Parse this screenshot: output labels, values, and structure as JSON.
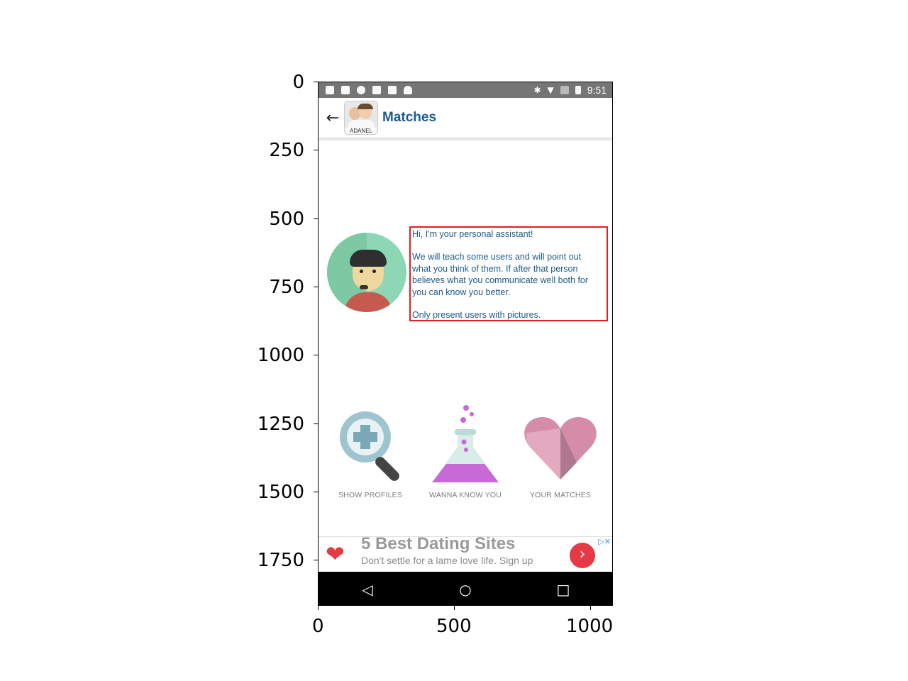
{
  "axes": {
    "y_ticks": [
      "0",
      "250",
      "500",
      "750",
      "1000",
      "1250",
      "1500",
      "1750"
    ],
    "x_ticks": [
      "0",
      "500",
      "1000"
    ]
  },
  "status_bar": {
    "time": "9:51",
    "left_icons": [
      "facebook-icon",
      "gallery-icon",
      "info-icon",
      "lock-icon",
      "tools-icon",
      "android-icon"
    ],
    "right_icons": [
      "bluetooth-icon",
      "wifi-icon",
      "no-signal-icon",
      "battery-icon"
    ]
  },
  "app_bar": {
    "back_icon": "arrow-left-icon",
    "logo_text": "ADANEL",
    "title": "Matches"
  },
  "assistant": {
    "greeting": "Hi, I'm your personal assistant!",
    "body": "We will teach some users and will point out\nwhat you think of them. If after that person\nbelieves what you communicate well both for\nyou can know you better.",
    "note": "Only present users with pictures."
  },
  "features": [
    {
      "label": "SHOW PROFILES",
      "icon": "magnifier-plus-icon"
    },
    {
      "label": "WANNA KNOW YOU",
      "icon": "flask-icon"
    },
    {
      "label": "YOUR MATCHES",
      "icon": "heart-icon"
    }
  ],
  "ad": {
    "title": "5 Best Dating Sites",
    "subtitle": "Don't settle for a lame love life. Sign up",
    "choices": "▷✕"
  },
  "nav": {
    "back": "◁",
    "home": "○",
    "recents": "□"
  },
  "colors": {
    "title": "#1e5a8c",
    "highlight_border": "#e02020",
    "ad_accent": "#e53945"
  }
}
